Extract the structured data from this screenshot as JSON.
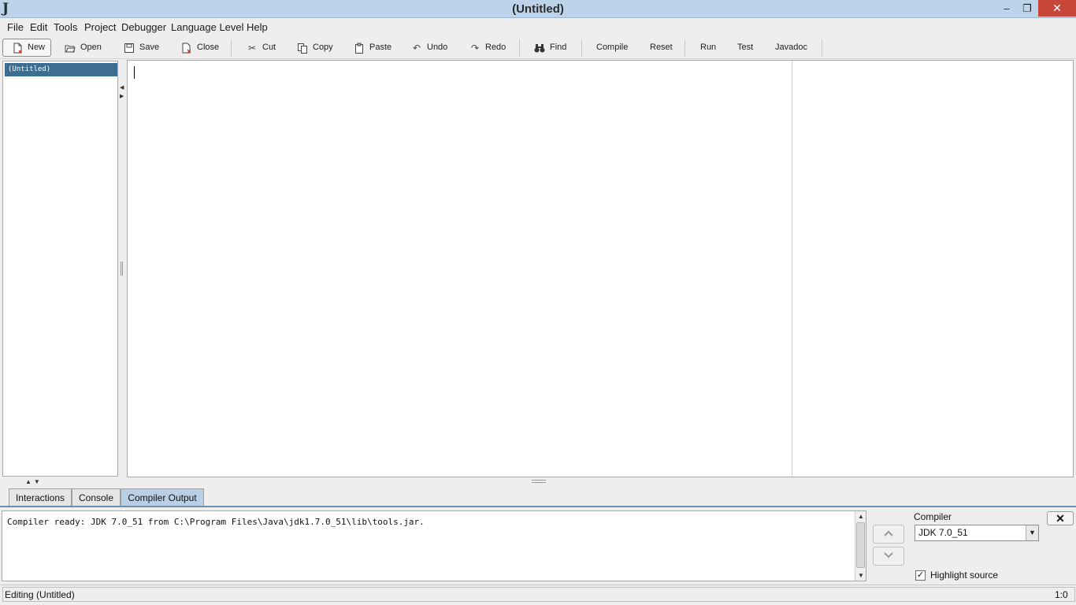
{
  "window": {
    "title": "(Untitled)",
    "app_icon_glyph": "J",
    "minimize_glyph": "‒",
    "maximize_glyph": "❐",
    "close_glyph": "✕"
  },
  "menu": {
    "items": [
      {
        "label": "File"
      },
      {
        "label": "Edit"
      },
      {
        "label": "Tools"
      },
      {
        "label": "Project"
      },
      {
        "label": "Debugger"
      },
      {
        "label": "Language Level"
      },
      {
        "label": "Help"
      }
    ]
  },
  "toolbar": {
    "buttons": [
      {
        "label": "New",
        "icon": "new-file-icon"
      },
      {
        "label": "Open",
        "icon": "open-folder-icon"
      },
      {
        "label": "Save",
        "icon": "save-disk-icon"
      },
      {
        "label": "Close",
        "icon": "close-file-icon"
      },
      {
        "label": "Cut",
        "icon": "scissors-icon"
      },
      {
        "label": "Copy",
        "icon": "copy-icon"
      },
      {
        "label": "Paste",
        "icon": "clipboard-icon"
      },
      {
        "label": "Undo",
        "icon": "undo-icon"
      },
      {
        "label": "Redo",
        "icon": "redo-icon"
      },
      {
        "label": "Find",
        "icon": "binoculars-icon"
      },
      {
        "label": "Compile"
      },
      {
        "label": "Reset"
      },
      {
        "label": "Run"
      },
      {
        "label": "Test"
      },
      {
        "label": "Javadoc"
      }
    ]
  },
  "file_tree": {
    "items": [
      {
        "label": "(Untitled)",
        "selected": true
      }
    ]
  },
  "bottom_panel": {
    "tabs": [
      {
        "label": "Interactions",
        "active": false
      },
      {
        "label": "Console",
        "active": false
      },
      {
        "label": "Compiler Output",
        "active": true
      }
    ],
    "output_text": "Compiler ready: JDK 7.0_51 from C:\\Program Files\\Java\\jdk1.7.0_51\\lib\\tools.jar.",
    "compiler_label": "Compiler",
    "compiler_selected": "JDK 7.0_51",
    "highlight_source_label": "Highlight source",
    "highlight_source_checked": true
  },
  "status": {
    "message": "Editing (Untitled)",
    "cursor_position": "1:0"
  },
  "colors": {
    "title_bar": "#bcd3ea",
    "selection": "#3d6d91",
    "active_tab": "#b8cfe5",
    "close_button": "#c7463a"
  }
}
